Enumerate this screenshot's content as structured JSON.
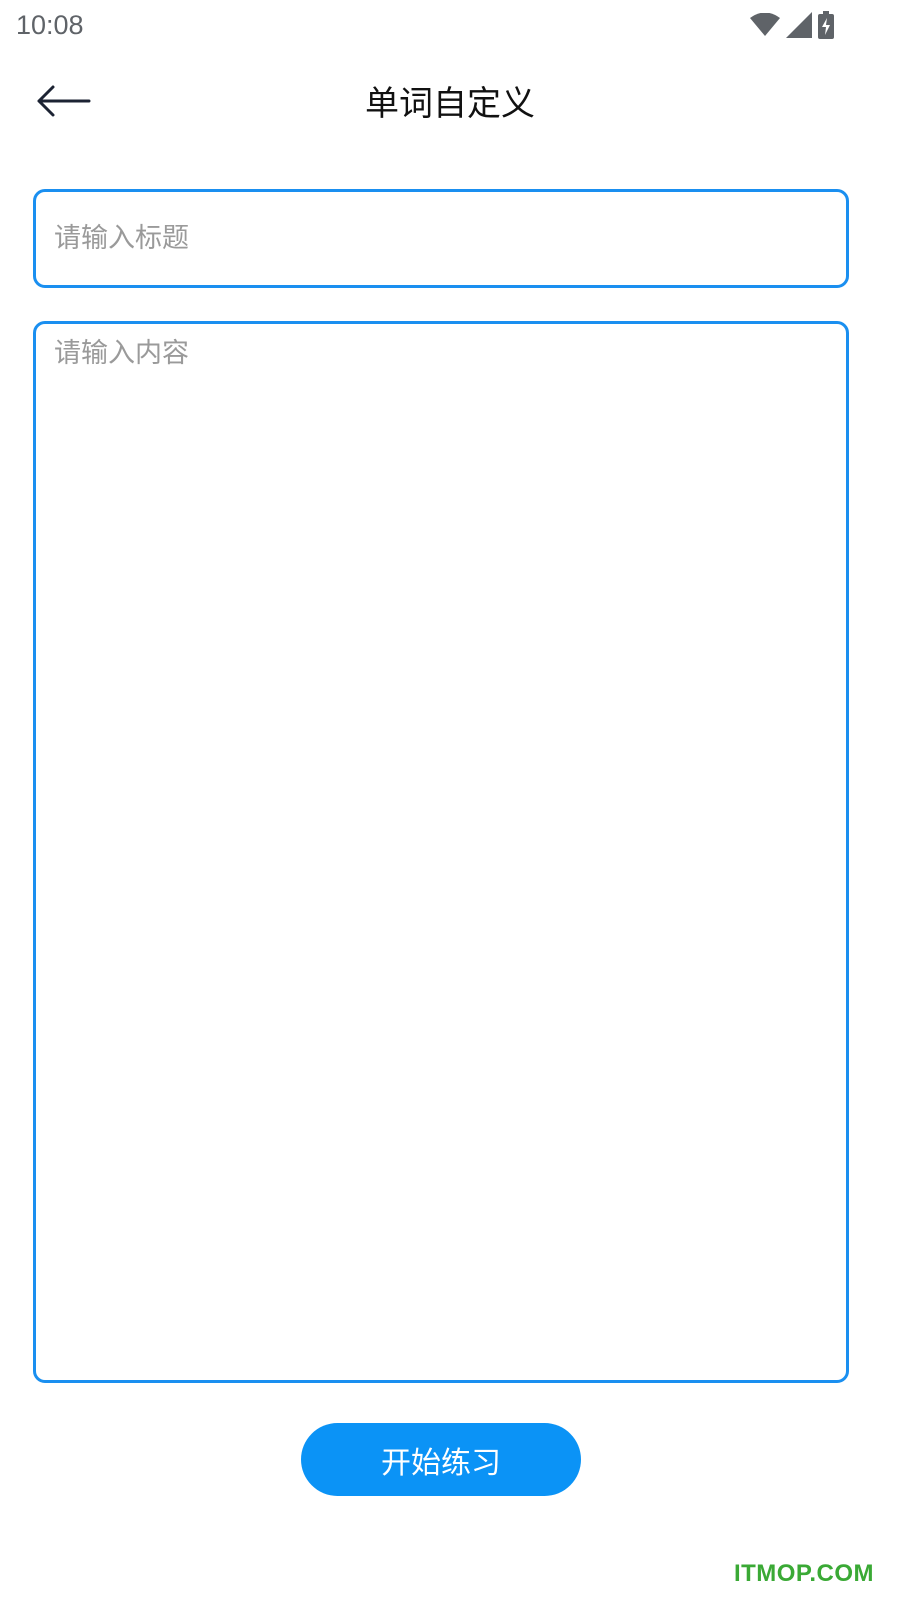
{
  "status_bar": {
    "time": "10:08",
    "icons": [
      "wifi-icon",
      "signal-icon",
      "battery-charging-icon"
    ]
  },
  "header": {
    "back_icon": "arrow-left-icon",
    "title": "单词自定义"
  },
  "form": {
    "title_input": {
      "placeholder": "请输入标题",
      "value": ""
    },
    "content_input": {
      "placeholder": "请输入内容",
      "value": ""
    }
  },
  "actions": {
    "start_label": "开始练习"
  },
  "watermark": {
    "text": "ITMOP.COM"
  },
  "colors": {
    "accent": "#1a8ff0",
    "button": "#0b93f6",
    "watermark": "#3aa935"
  }
}
